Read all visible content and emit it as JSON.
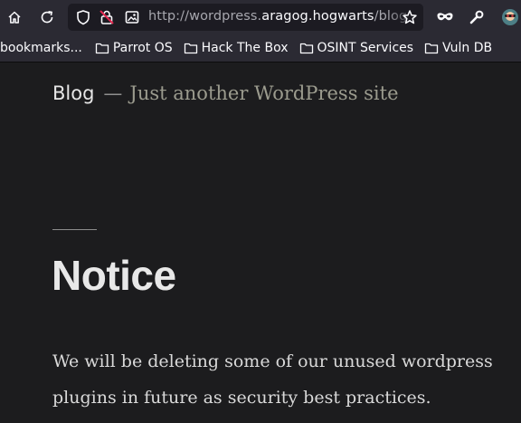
{
  "browser": {
    "url_prefix": "http://wordpress.",
    "url_host": "aragog.hogwarts",
    "url_suffix": "/blog",
    "bookmarks": [
      {
        "label": "bookmarks..."
      },
      {
        "label": "Parrot OS"
      },
      {
        "label": "Hack The Box"
      },
      {
        "label": "OSINT Services"
      },
      {
        "label": "Vuln DB"
      }
    ]
  },
  "site": {
    "title": "Blog",
    "separator": "—",
    "description": "Just another WordPress site"
  },
  "post": {
    "title": "Notice",
    "content": "We will be deleting some of our unused wordpress plugins in future as security best practices."
  }
}
